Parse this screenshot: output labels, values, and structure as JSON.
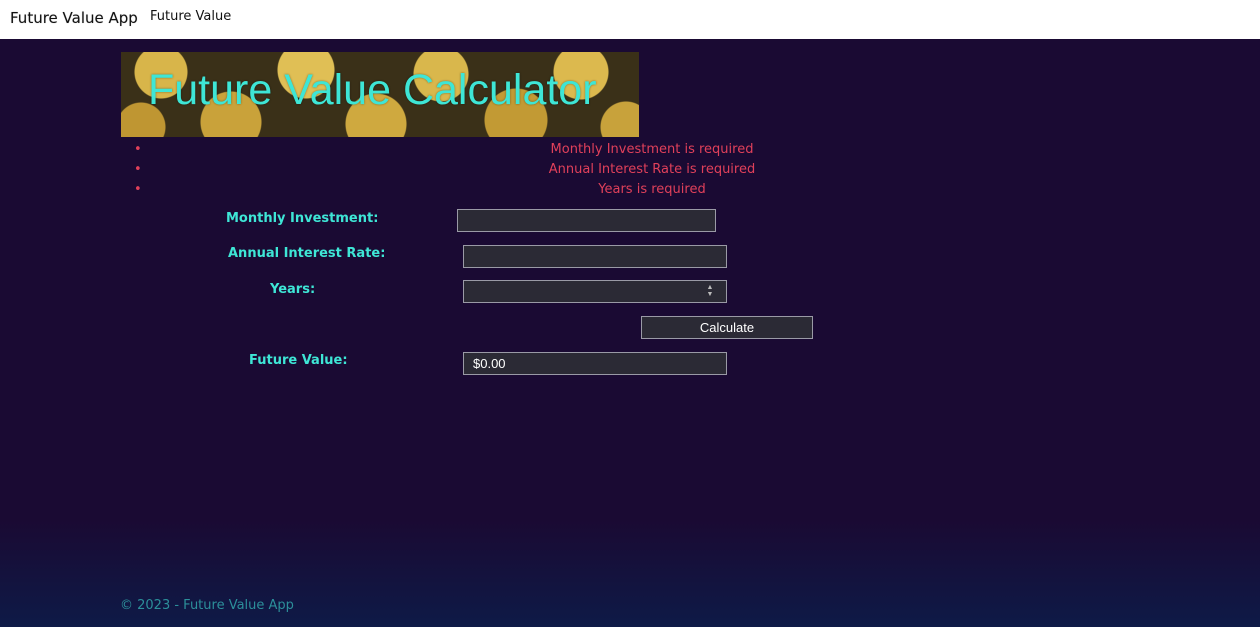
{
  "navbar": {
    "brand": "Future Value App",
    "link": "Future Value"
  },
  "banner": {
    "title": "Future Value Calculator"
  },
  "errors": [
    "Monthly Investment is required",
    "Annual Interest Rate is required",
    "Years is required"
  ],
  "form": {
    "monthly_investment_label": "Monthly Investment:",
    "monthly_investment_value": "",
    "annual_interest_rate_label": "Annual Interest Rate:",
    "annual_interest_rate_value": "",
    "years_label": "Years:",
    "years_value": "",
    "calculate_label": "Calculate",
    "future_value_label": "Future Value:",
    "future_value_value": "$0.00"
  },
  "footer": {
    "text": "© 2023 - Future Value App"
  },
  "colors": {
    "accent": "#3ee6d6",
    "error": "#e0405a",
    "background": "#1a0a33"
  }
}
